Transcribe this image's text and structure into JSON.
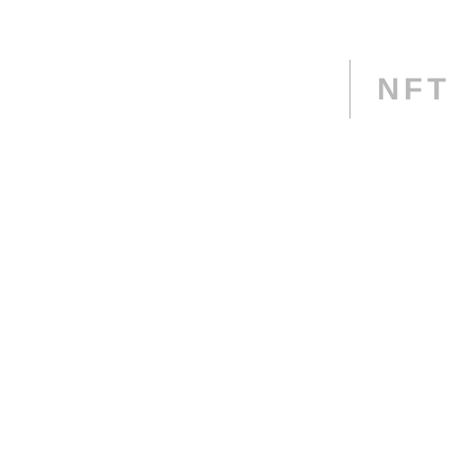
{
  "header": {
    "brand_label": "NFT"
  },
  "colors": {
    "background": "#ffffff",
    "divider": "#cfcfcf",
    "brand_text": "#b8b8b8"
  }
}
